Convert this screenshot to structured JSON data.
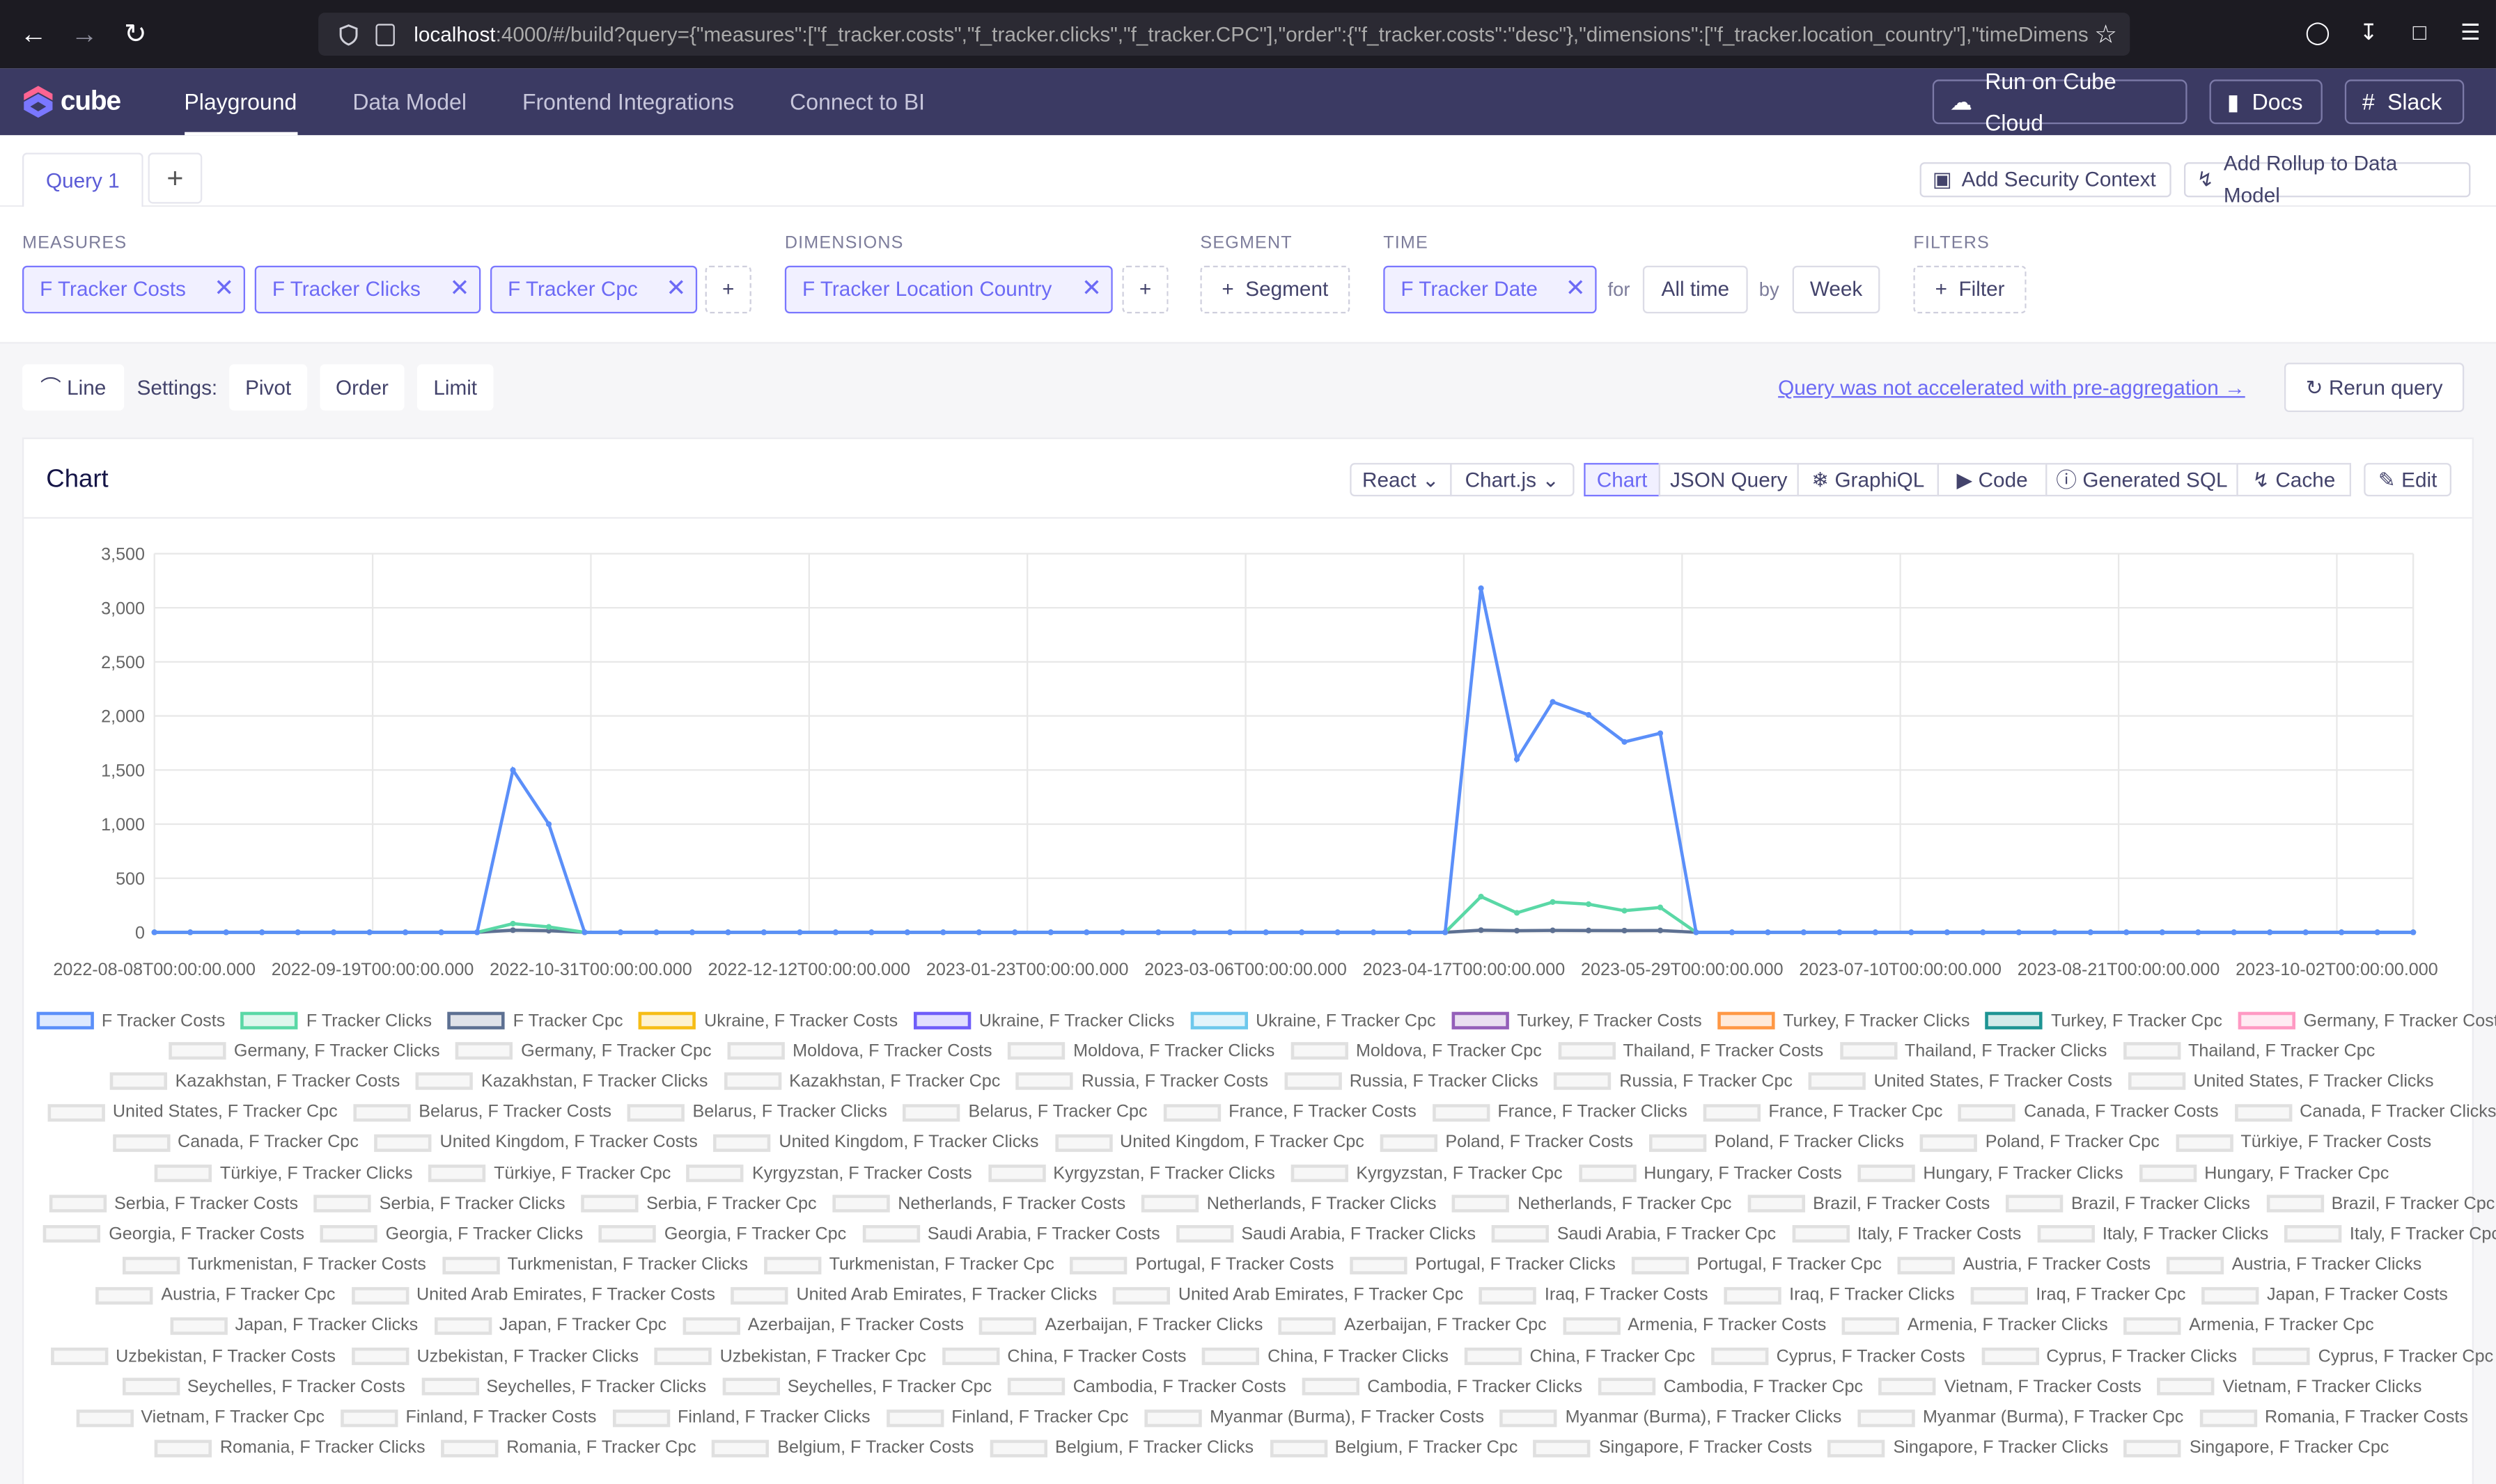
{
  "browser": {
    "url_host": "localhost",
    "url_rest": ":4000/#/build?query={\"measures\":[\"f_tracker.costs\",\"f_tracker.clicks\",\"f_tracker.CPC\"],\"order\":{\"f_tracker.costs\":\"desc\"},\"dimensions\":[\"f_tracker.location_country\"],\"timeDimens"
  },
  "app": {
    "logo": "cube",
    "nav": [
      "Playground",
      "Data Model",
      "Frontend Integrations",
      "Connect to BI"
    ],
    "run_cloud": "Run on Cube Cloud",
    "docs": "Docs",
    "slack": "Slack"
  },
  "query_tabs": {
    "tab": "Query 1",
    "plus": "+",
    "add_security": "Add Security Context",
    "add_rollup": "Add Rollup to Data Model"
  },
  "builder": {
    "measures_label": "MEASURES",
    "measures": [
      "F Tracker Costs",
      "F Tracker Clicks",
      "F Tracker Cpc"
    ],
    "dimensions_label": "DIMENSIONS",
    "dimension": "F Tracker Location Country",
    "segment_label": "SEGMENT",
    "segment_btn": "Segment",
    "time_label": "TIME",
    "time_dim": "F Tracker Date",
    "for": "for",
    "range": "All time",
    "by": "by",
    "granularity": "Week",
    "filters_label": "FILTERS",
    "filter_btn": "Filter"
  },
  "settings": {
    "chart_type": "Line",
    "label": "Settings:",
    "pivot": "Pivot",
    "order": "Order",
    "limit": "Limit",
    "accel_link": "Query was not accelerated with pre-aggregation →",
    "rerun": "Rerun query"
  },
  "chart_card": {
    "title": "Chart",
    "react": "React",
    "chartjs": "Chart.js",
    "tabs": [
      "Chart",
      "JSON Query",
      "GraphiQL",
      "Code",
      "Generated SQL",
      "Cache",
      "Edit"
    ]
  },
  "chart_data": {
    "type": "line",
    "ylim": [
      0,
      3500
    ],
    "yticks": [
      "0",
      "500",
      "1,000",
      "1,500",
      "2,000",
      "2,500",
      "3,000",
      "3,500"
    ],
    "xticks": [
      "2022-08-08T00:00:00.000",
      "2022-09-19T00:00:00.000",
      "2022-10-31T00:00:00.000",
      "2022-12-12T00:00:00.000",
      "2023-01-23T00:00:00.000",
      "2023-03-06T00:00:00.000",
      "2023-04-17T00:00:00.000",
      "2023-05-29T00:00:00.000",
      "2023-07-10T00:00:00.000",
      "2023-08-21T00:00:00.000",
      "2023-10-02T00:00:00.000"
    ],
    "series": [
      {
        "name": "F Tracker Costs",
        "color": "#5b8ff9",
        "values": [
          0,
          0,
          0,
          0,
          0,
          0,
          0,
          0,
          0,
          0,
          1500,
          1000,
          0,
          0,
          0,
          0,
          0,
          0,
          0,
          0,
          0,
          0,
          0,
          0,
          0,
          0,
          0,
          0,
          0,
          0,
          0,
          0,
          0,
          0,
          0,
          0,
          0,
          3180,
          1600,
          2130,
          2010,
          1760,
          1840,
          0,
          0,
          0,
          0,
          0,
          0,
          0,
          0,
          0,
          0,
          0,
          0,
          0,
          0,
          0,
          0,
          0,
          0,
          0,
          0,
          0
        ]
      },
      {
        "name": "F Tracker Clicks",
        "color": "#5ad8a6",
        "values": [
          0,
          0,
          0,
          0,
          0,
          0,
          0,
          0,
          0,
          0,
          80,
          50,
          0,
          0,
          0,
          0,
          0,
          0,
          0,
          0,
          0,
          0,
          0,
          0,
          0,
          0,
          0,
          0,
          0,
          0,
          0,
          0,
          0,
          0,
          0,
          0,
          0,
          330,
          180,
          280,
          260,
          200,
          230,
          0,
          0,
          0,
          0,
          0,
          0,
          0,
          0,
          0,
          0,
          0,
          0,
          0,
          0,
          0,
          0,
          0,
          0,
          0,
          0,
          0
        ]
      },
      {
        "name": "F Tracker Cpc",
        "color": "#5d7092",
        "values": [
          0,
          0,
          0,
          0,
          0,
          0,
          0,
          0,
          0,
          0,
          20,
          15,
          0,
          0,
          0,
          0,
          0,
          0,
          0,
          0,
          0,
          0,
          0,
          0,
          0,
          0,
          0,
          0,
          0,
          0,
          0,
          0,
          0,
          0,
          0,
          0,
          0,
          20,
          15,
          18,
          17,
          16,
          17,
          0,
          0,
          0,
          0,
          0,
          0,
          0,
          0,
          0,
          0,
          0,
          0,
          0,
          0,
          0,
          0,
          0,
          0,
          0,
          0,
          0
        ]
      }
    ],
    "legend": [
      [
        "F Tracker Costs",
        "F Tracker Clicks",
        "F Tracker Cpc",
        "Ukraine, F Tracker Costs",
        "Ukraine, F Tracker Clicks",
        "Ukraine, F Tracker Cpc",
        "Turkey, F Tracker Costs",
        "Turkey, F Tracker Clicks",
        "Turkey, F Tracker Cpc",
        "Germany, F Tracker Costs"
      ],
      [
        "Germany, F Tracker Clicks",
        "Germany, F Tracker Cpc",
        "Moldova, F Tracker Costs",
        "Moldova, F Tracker Clicks",
        "Moldova, F Tracker Cpc",
        "Thailand, F Tracker Costs",
        "Thailand, F Tracker Clicks",
        "Thailand, F Tracker Cpc"
      ],
      [
        "Kazakhstan, F Tracker Costs",
        "Kazakhstan, F Tracker Clicks",
        "Kazakhstan, F Tracker Cpc",
        "Russia, F Tracker Costs",
        "Russia, F Tracker Clicks",
        "Russia, F Tracker Cpc",
        "United States, F Tracker Costs",
        "United States, F Tracker Clicks"
      ],
      [
        "United States, F Tracker Cpc",
        "Belarus, F Tracker Costs",
        "Belarus, F Tracker Clicks",
        "Belarus, F Tracker Cpc",
        "France, F Tracker Costs",
        "France, F Tracker Clicks",
        "France, F Tracker Cpc",
        "Canada, F Tracker Costs",
        "Canada, F Tracker Clicks"
      ],
      [
        "Canada, F Tracker Cpc",
        "United Kingdom, F Tracker Costs",
        "United Kingdom, F Tracker Clicks",
        "United Kingdom, F Tracker Cpc",
        "Poland, F Tracker Costs",
        "Poland, F Tracker Clicks",
        "Poland, F Tracker Cpc",
        "Türkiye, F Tracker Costs"
      ],
      [
        "Türkiye, F Tracker Clicks",
        "Türkiye, F Tracker Cpc",
        "Kyrgyzstan, F Tracker Costs",
        "Kyrgyzstan, F Tracker Clicks",
        "Kyrgyzstan, F Tracker Cpc",
        "Hungary, F Tracker Costs",
        "Hungary, F Tracker Clicks",
        "Hungary, F Tracker Cpc"
      ],
      [
        "Serbia, F Tracker Costs",
        "Serbia, F Tracker Clicks",
        "Serbia, F Tracker Cpc",
        "Netherlands, F Tracker Costs",
        "Netherlands, F Tracker Clicks",
        "Netherlands, F Tracker Cpc",
        "Brazil, F Tracker Costs",
        "Brazil, F Tracker Clicks",
        "Brazil, F Tracker Cpc"
      ],
      [
        "Georgia, F Tracker Costs",
        "Georgia, F Tracker Clicks",
        "Georgia, F Tracker Cpc",
        "Saudi Arabia, F Tracker Costs",
        "Saudi Arabia, F Tracker Clicks",
        "Saudi Arabia, F Tracker Cpc",
        "Italy, F Tracker Costs",
        "Italy, F Tracker Clicks",
        "Italy, F Tracker Cpc"
      ],
      [
        "Turkmenistan, F Tracker Costs",
        "Turkmenistan, F Tracker Clicks",
        "Turkmenistan, F Tracker Cpc",
        "Portugal, F Tracker Costs",
        "Portugal, F Tracker Clicks",
        "Portugal, F Tracker Cpc",
        "Austria, F Tracker Costs",
        "Austria, F Tracker Clicks"
      ],
      [
        "Austria, F Tracker Cpc",
        "United Arab Emirates, F Tracker Costs",
        "United Arab Emirates, F Tracker Clicks",
        "United Arab Emirates, F Tracker Cpc",
        "Iraq, F Tracker Costs",
        "Iraq, F Tracker Clicks",
        "Iraq, F Tracker Cpc",
        "Japan, F Tracker Costs"
      ],
      [
        "Japan, F Tracker Clicks",
        "Japan, F Tracker Cpc",
        "Azerbaijan, F Tracker Costs",
        "Azerbaijan, F Tracker Clicks",
        "Azerbaijan, F Tracker Cpc",
        "Armenia, F Tracker Costs",
        "Armenia, F Tracker Clicks",
        "Armenia, F Tracker Cpc"
      ],
      [
        "Uzbekistan, F Tracker Costs",
        "Uzbekistan, F Tracker Clicks",
        "Uzbekistan, F Tracker Cpc",
        "China, F Tracker Costs",
        "China, F Tracker Clicks",
        "China, F Tracker Cpc",
        "Cyprus, F Tracker Costs",
        "Cyprus, F Tracker Clicks",
        "Cyprus, F Tracker Cpc"
      ],
      [
        "Seychelles, F Tracker Costs",
        "Seychelles, F Tracker Clicks",
        "Seychelles, F Tracker Cpc",
        "Cambodia, F Tracker Costs",
        "Cambodia, F Tracker Clicks",
        "Cambodia, F Tracker Cpc",
        "Vietnam, F Tracker Costs",
        "Vietnam, F Tracker Clicks"
      ],
      [
        "Vietnam, F Tracker Cpc",
        "Finland, F Tracker Costs",
        "Finland, F Tracker Clicks",
        "Finland, F Tracker Cpc",
        "Myanmar (Burma), F Tracker Costs",
        "Myanmar (Burma), F Tracker Clicks",
        "Myanmar (Burma), F Tracker Cpc",
        "Romania, F Tracker Costs"
      ],
      [
        "Romania, F Tracker Clicks",
        "Romania, F Tracker Cpc",
        "Belgium, F Tracker Costs",
        "Belgium, F Tracker Clicks",
        "Belgium, F Tracker Cpc",
        "Singapore, F Tracker Costs",
        "Singapore, F Tracker Clicks",
        "Singapore, F Tracker Cpc"
      ]
    ],
    "legend_colors": [
      "#5b8ff9",
      "#5ad8a6",
      "#5d7092",
      "#f6bd16",
      "#6f5ef9",
      "#6dc8ec",
      "#945fb9",
      "#ff9845",
      "#1e9493",
      "#ff99c3"
    ]
  }
}
